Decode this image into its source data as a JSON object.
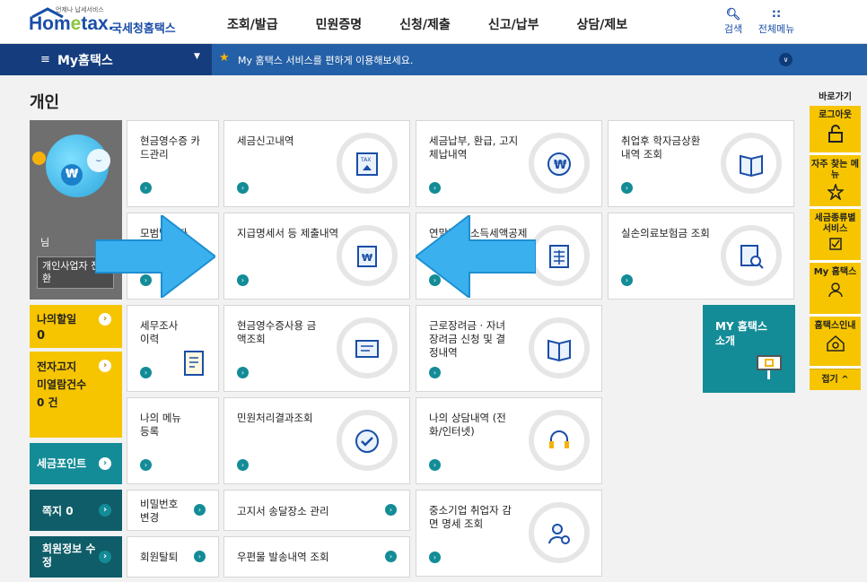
{
  "header": {
    "logo_small": "언제나 납세서비스",
    "logo_main_a": "Hom",
    "logo_main_e": "e",
    "logo_main_b": "tax.",
    "logo_kr": "국세청홈택스",
    "search_label": "검색",
    "menu_label": "전체메뉴"
  },
  "nav": [
    "조회/발급",
    "민원증명",
    "신청/제출",
    "신고/납부",
    "상담/제보"
  ],
  "bar": {
    "my_label": "My홈택스",
    "message": "My 홈택스 서비스를 편하게 이용해보세요."
  },
  "page_title": "개인",
  "profile": {
    "name": "님",
    "switch_label": "개인사업자 전환"
  },
  "left": {
    "my_discount": {
      "label": "나의할일",
      "count": "0"
    },
    "e_notice": {
      "label1": "전자고지",
      "label2": "미열람건수",
      "count": "0",
      "unit": "건"
    },
    "tax_point": {
      "label": "세금포인트"
    },
    "memo": {
      "label": "쪽지",
      "count": "0"
    },
    "member": {
      "label": "회원정보 수정"
    }
  },
  "tiles": {
    "t1": "현금영수증 카드관리",
    "t2": "세금신고내역",
    "t3": "세금납부, 환급, 고지 체납내역",
    "t4": "취업후 학자금상환 내역 조회",
    "t5": "모범납세자",
    "t6": "지급명세서 등 제출내역",
    "t7": "연말정산 소득세액공제",
    "t8": "실손의료보험금 조회",
    "t9": "세무조사 이력",
    "t10": "현금영수증사용 금액조회",
    "t11": "근로장려금 · 자녀장려금 신청 및 결정내역",
    "t12": "나의 메뉴 등록",
    "t13": "민원처리결과조회",
    "t14": "나의 상담내역 (전화/인터넷)",
    "t15": "비밀번호 변경",
    "t16": "고지서 송달장소 관리",
    "t17": "중소기업 취업자 감면 명세 조회",
    "t18": "회원탈퇴",
    "t19": "우편물 발송내역 조회",
    "my_intro": "MY 홈택스 소개"
  },
  "quick": {
    "title": "바로가기",
    "items": [
      "로그아웃",
      "자주 찾는 메뉴",
      "세금종류별 서비스",
      "My 홈택스",
      "홈택스인내"
    ],
    "fold": "접기 ^"
  },
  "colors": {
    "navy": "#2460a7",
    "teal": "#138c97",
    "yellow": "#f6c500"
  }
}
